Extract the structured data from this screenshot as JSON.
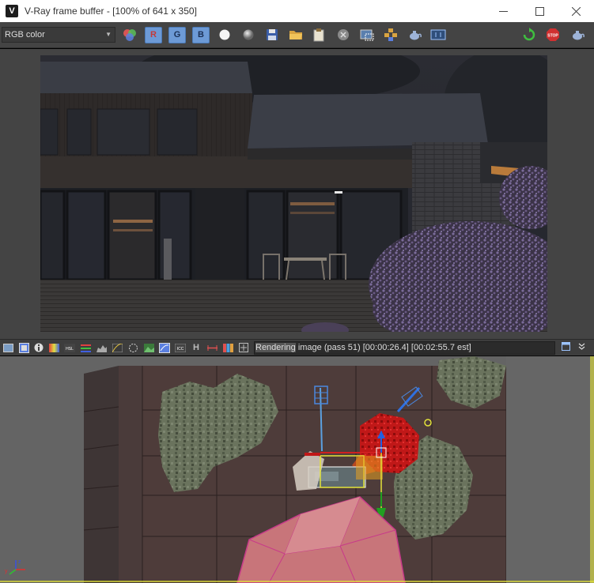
{
  "window": {
    "app_logo": "V-Ray logo",
    "title": "V-Ray frame buffer - [100% of 641 x 350]",
    "controls": [
      "minimize-icon",
      "maximize-icon",
      "close-icon"
    ]
  },
  "toolbar": {
    "channel_value": "RGB color",
    "color_channel_buttons": [
      "R",
      "G",
      "B"
    ],
    "icons": [
      "color-channels-icon",
      "red-channel-button",
      "green-channel-button",
      "blue-channel-button",
      "white-circle-icon",
      "gray-circle-icon",
      "save-image-icon",
      "open-folder-icon",
      "clipboard-icon",
      "clear-image-icon",
      "region-render-icon",
      "track-mouse-icon",
      "teapot-render-icon",
      "history-icon",
      "refresh-icon",
      "stop-render-icon",
      "teapot-options-icon"
    ],
    "stop_label": "STOP"
  },
  "render_image": {
    "scene": "dusk render of a two-storey timber-clad house with lit interior, outdoor table and chairs, flowering shrubs"
  },
  "status": {
    "text_highlight": "Rendering",
    "text_rest": " image (pass 51) [00:00:26.4] [00:02:55.7 est]",
    "letter_icon_h": "H"
  },
  "viewport": {
    "axis_labels": {
      "y": "y",
      "z": "z",
      "x": "x"
    }
  },
  "colors": {
    "panel_bg": "#444444",
    "status_bg": "#3d3d3d",
    "button_blue": "#6d9ad6",
    "viewport_floor": "#4e3c3a",
    "selection_yellow": "#e3e33a",
    "rock_pink": "#c8757a"
  }
}
